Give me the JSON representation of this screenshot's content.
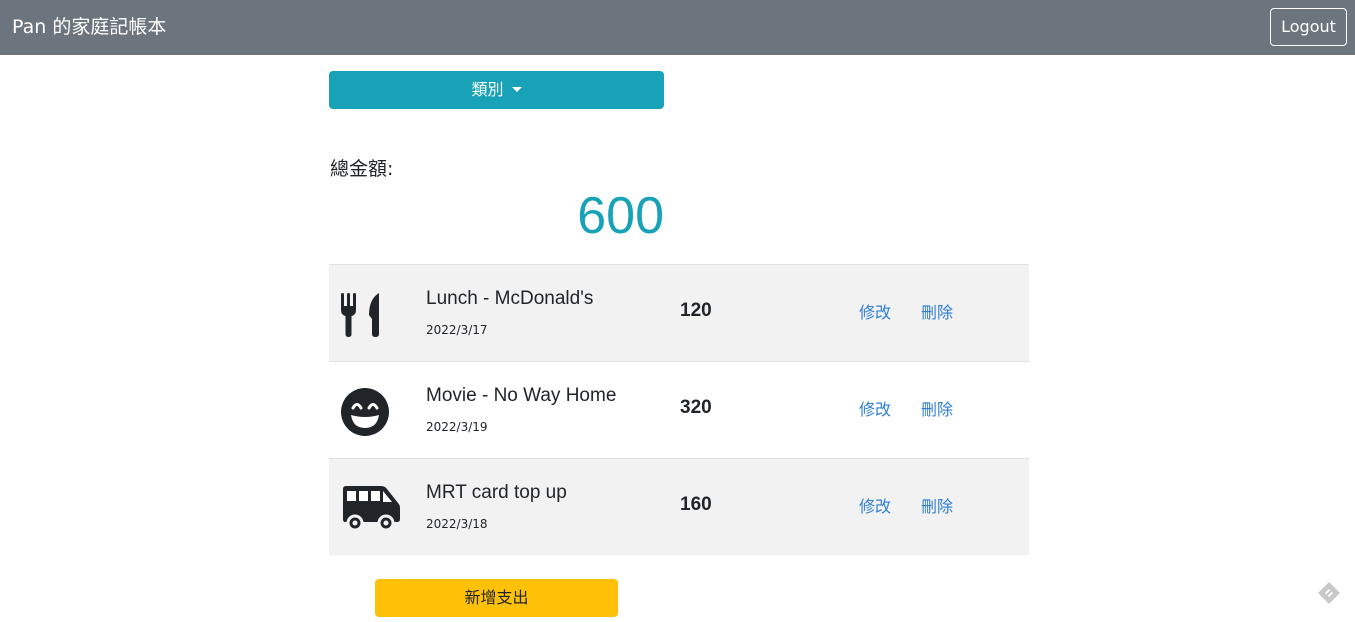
{
  "navbar": {
    "brand": "Pan 的家庭記帳本",
    "logout_label": "Logout"
  },
  "filter": {
    "category_label": "類別"
  },
  "summary": {
    "total_label": "總金額:",
    "total_amount": "600"
  },
  "records": [
    {
      "icon": "utensils-icon",
      "title": "Lunch - McDonald's",
      "date": "2022/3/17",
      "amount": "120",
      "edit_label": "修改",
      "delete_label": "刪除"
    },
    {
      "icon": "grin-icon",
      "title": "Movie - No Way Home",
      "date": "2022/3/19",
      "amount": "320",
      "edit_label": "修改",
      "delete_label": "刪除"
    },
    {
      "icon": "shuttle-van-icon",
      "title": "MRT card top up",
      "date": "2022/3/18",
      "amount": "160",
      "edit_label": "修改",
      "delete_label": "刪除"
    }
  ],
  "actions": {
    "add_label": "新增支出"
  },
  "colors": {
    "navbar": "#6c757d",
    "info": "#17a2b8",
    "warning": "#ffc107",
    "link": "#2f7fd6"
  }
}
